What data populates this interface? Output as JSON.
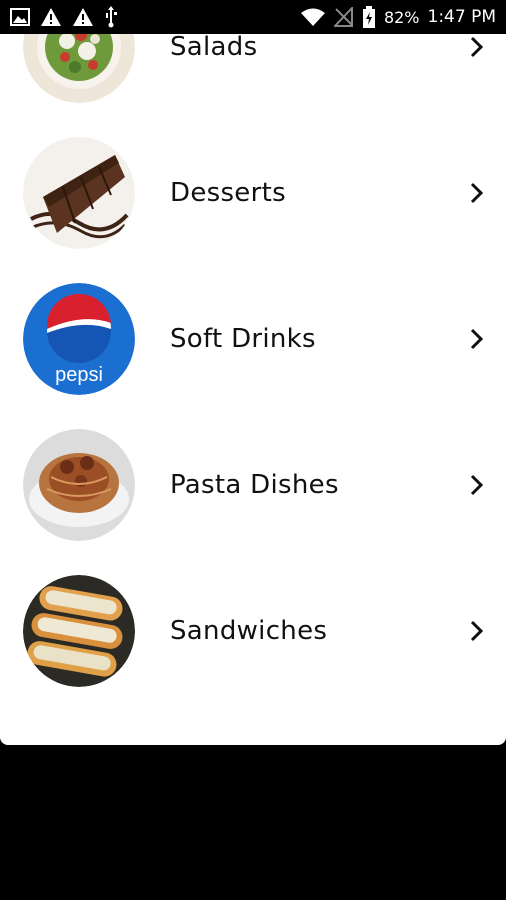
{
  "status_bar": {
    "battery_percent": "82%",
    "time": "1:47 PM"
  },
  "categories": [
    {
      "label": "Salads"
    },
    {
      "label": "Desserts"
    },
    {
      "label": "Soft Drinks",
      "logo_text": "pepsi"
    },
    {
      "label": "Pasta Dishes"
    },
    {
      "label": "Sandwiches"
    }
  ]
}
